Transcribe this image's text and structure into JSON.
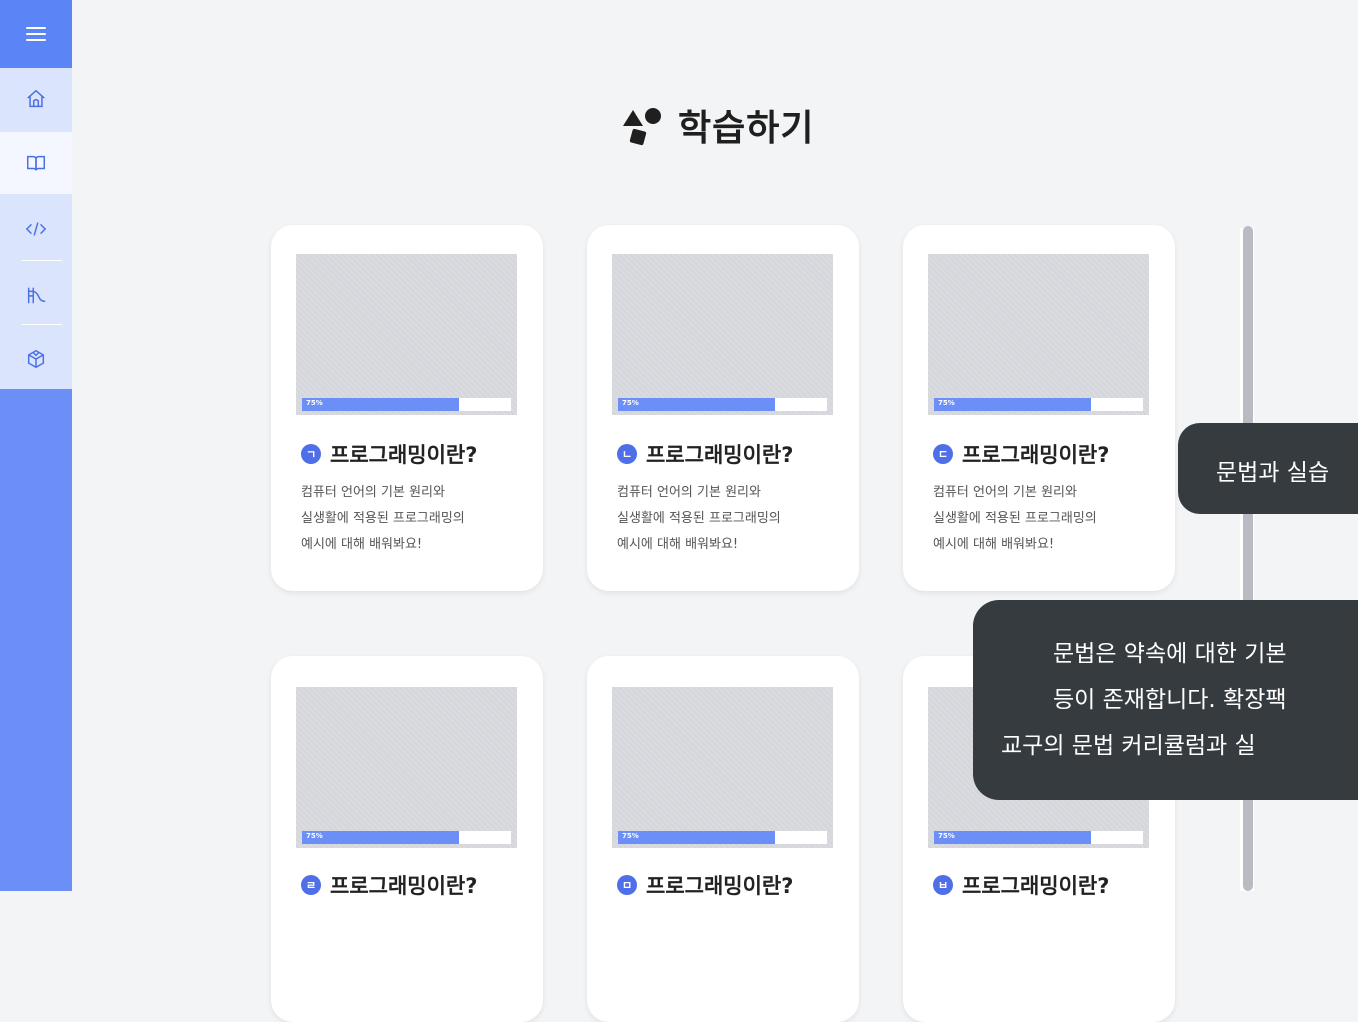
{
  "page_title": "학습하기",
  "colors": {
    "sidebar": "#6b8ff7",
    "accent": "#4f6fe8",
    "progress": "#6b8ff7",
    "tooltip": "#363b3f"
  },
  "sidebar": {
    "menu_icon": "hamburger-icon",
    "items": [
      {
        "icon": "home-icon"
      },
      {
        "icon": "book-icon",
        "active": true
      },
      {
        "icon": "code-icon"
      },
      {
        "icon": "slide-icon"
      },
      {
        "icon": "box-icon"
      }
    ]
  },
  "cards": [
    {
      "badge": "ㄱ",
      "title": "프로그래밍이란?",
      "progress": 75,
      "progress_label": "75%",
      "desc": [
        "컴퓨터 언어의 기본 원리와",
        "실생활에 적용된 프로그래밍의",
        "예시에 대해 배워봐요!"
      ]
    },
    {
      "badge": "ㄴ",
      "title": "프로그래밍이란?",
      "progress": 75,
      "progress_label": "75%",
      "desc": [
        "컴퓨터 언어의 기본 원리와",
        "실생활에 적용된 프로그래밍의",
        "예시에 대해 배워봐요!"
      ]
    },
    {
      "badge": "ㄷ",
      "title": "프로그래밍이란?",
      "progress": 75,
      "progress_label": "75%",
      "desc": [
        "컴퓨터 언어의 기본 원리와",
        "실생활에 적용된 프로그래밍의",
        "예시에 대해 배워봐요!"
      ]
    },
    {
      "badge": "ㄹ",
      "title": "프로그래밍이란?",
      "progress": 75,
      "progress_label": "75%",
      "desc": []
    },
    {
      "badge": "ㅁ",
      "title": "프로그래밍이란?",
      "progress": 75,
      "progress_label": "75%",
      "desc": []
    },
    {
      "badge": "ㅂ",
      "title": "프로그래밍이란?",
      "progress": 75,
      "progress_label": "75%",
      "desc": []
    }
  ],
  "tooltips": {
    "short": "문법과 실습",
    "long": [
      "문법은 약속에 대한 기본",
      "등이 존재합니다. 확장팩",
      "교구의 문법 커리큘럼과 실"
    ]
  }
}
